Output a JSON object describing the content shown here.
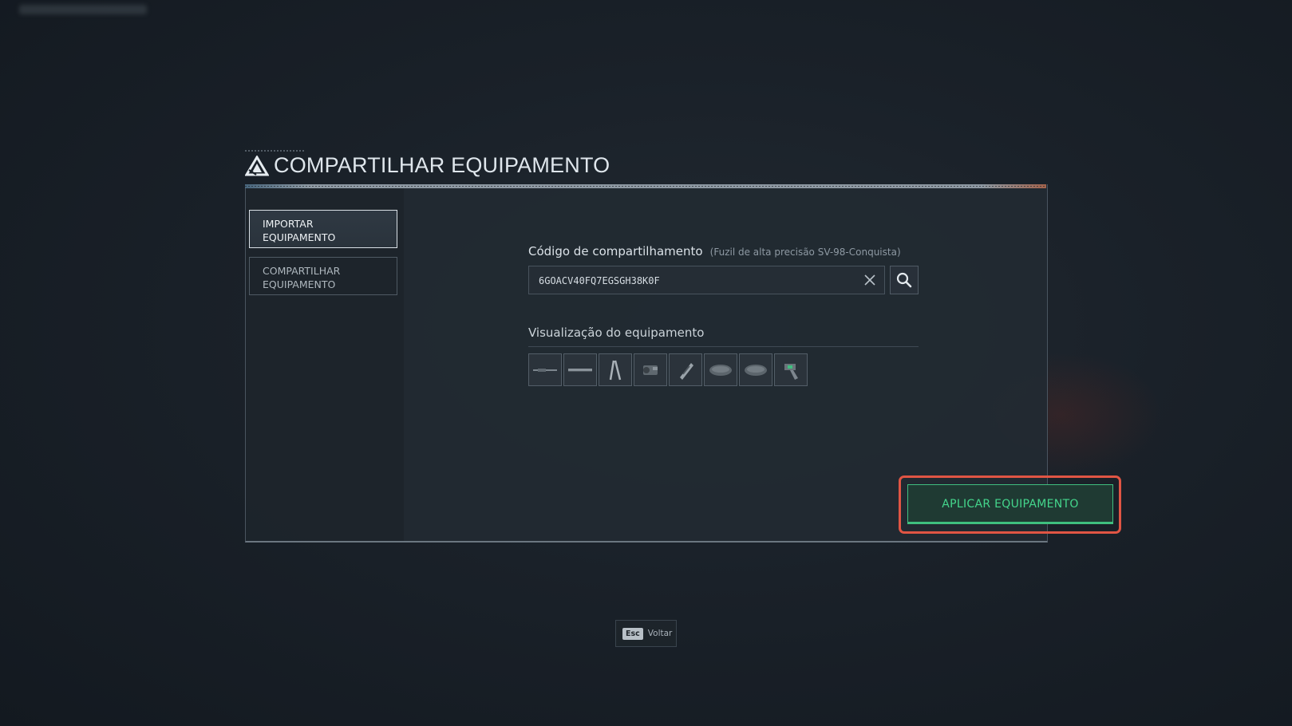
{
  "dialog": {
    "title": "COMPARTILHAR EQUIPAMENTO",
    "logo_icon": "triangle-logo-icon"
  },
  "sidebar": {
    "tabs": [
      {
        "line1": "IMPORTAR",
        "line2": "EQUIPAMENTO",
        "active": true
      },
      {
        "line1": "COMPARTILHAR",
        "line2": "EQUIPAMENTO",
        "active": false
      }
    ]
  },
  "share_code": {
    "label": "Código de compartilhamento",
    "sublabel": "(Fuzil de alta precisão SV-98-Conquista)",
    "value": "6GOACV40FQ7EGSGH38K0F",
    "clear_icon": "close-icon",
    "search_icon": "search-icon"
  },
  "preview": {
    "label": "Visualização do equipamento",
    "slots": [
      "rifle-icon",
      "barrel-icon",
      "bipod-icon",
      "scope-icon",
      "muzzle-icon",
      "magazine-icon",
      "stock-icon",
      "grip-icon"
    ]
  },
  "apply_button": {
    "label": "APLICAR EQUIPAMENTO"
  },
  "footer": {
    "key": "Esc",
    "label": "Voltar"
  },
  "colors": {
    "accent_green": "#44d68c",
    "highlight_red": "#e05544"
  }
}
